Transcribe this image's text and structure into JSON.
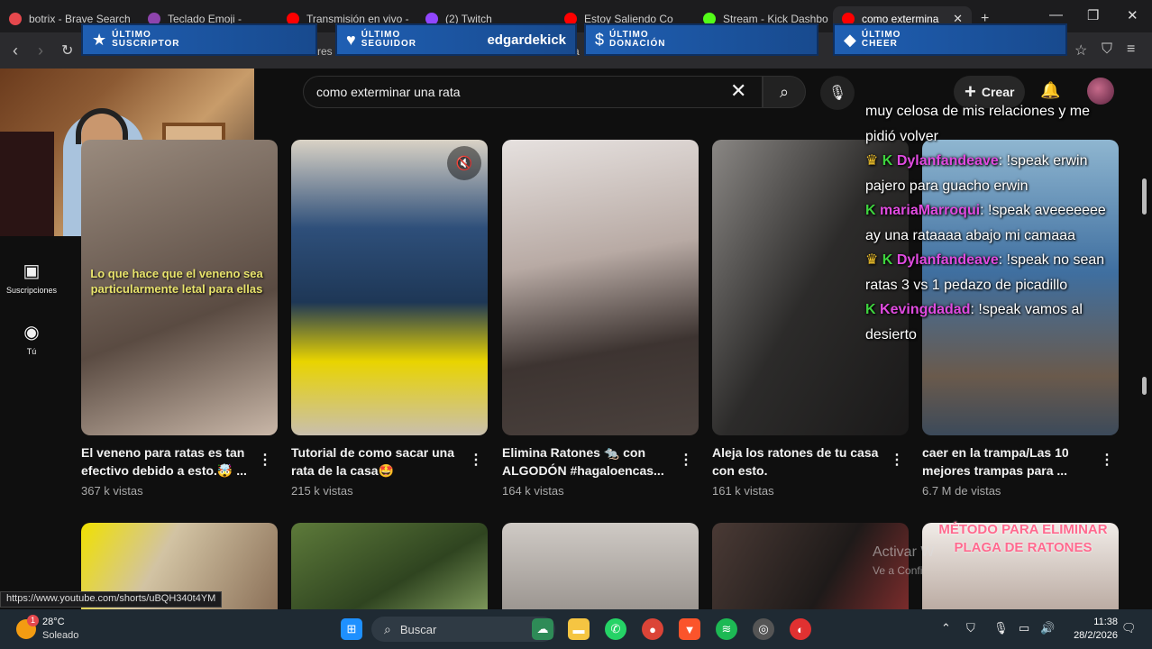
{
  "tabs": [
    {
      "title": "botrix - Brave Search",
      "color": "#e5484d"
    },
    {
      "title": "Teclado Emoji -",
      "color": "#8e44ad"
    },
    {
      "title": "Transmisión en vivo -",
      "color": "#ff0000"
    },
    {
      "title": "(2) Twitch",
      "color": "#9146ff"
    },
    {
      "title": "Estoy Saliendo Co",
      "color": "#ff0000"
    },
    {
      "title": "Stream - Kick Dashbo",
      "color": "#53fc18"
    },
    {
      "title": "como extermina",
      "color": "#ff0000",
      "active": true
    }
  ],
  "address": {
    "url_fragment_1": "res",
    "url_fragment_2": "uta"
  },
  "overlays": {
    "subscriber": {
      "label_1": "ÚLTIMO",
      "label_2": "SUSCRIPTOR",
      "value": ""
    },
    "follower": {
      "label_1": "ÚLTIMO",
      "label_2": "SEGUIDOR",
      "value": "edgardekick"
    },
    "donation": {
      "label_1": "ÚLTIMO",
      "label_2": "DONACIÓN",
      "value": ""
    },
    "cheer": {
      "label_1": "ÚLTIMO",
      "label_2": "CHEER",
      "value": ""
    }
  },
  "youtube": {
    "search_value": "como exterminar una rata",
    "create_label": "Crear",
    "sidebar": [
      {
        "label": "Suscripciones",
        "icon": "subscriptions-icon"
      },
      {
        "label": "Tú",
        "icon": "you-icon"
      }
    ]
  },
  "shorts": [
    {
      "title_1": "El veneno para ratas es tan",
      "title_2": "efectivo debido a esto.🤯 ...",
      "views": "367 k vistas",
      "thumb_text": "Lo que hace que el veneno sea particularmente letal para ellas"
    },
    {
      "title_1": "Tutorial de como sacar una",
      "title_2": "rata de la casa🤩",
      "views": "215 k vistas"
    },
    {
      "title_1": "Elimina Ratones 🐀 con",
      "title_2": "ALGODÓN #hagaloencas...",
      "views": "164 k vistas"
    },
    {
      "title_1": "Aleja los ratones de tu casa",
      "title_2": "con esto.",
      "views": "161 k vistas"
    },
    {
      "title_1": "caer en la trampa/Las 10",
      "title_2": "mejores trampas para ...",
      "views": "6.7 M de vistas"
    }
  ],
  "row2": {
    "method_text": "MÉTODO PARA ELIMINAR PLAGA DE RATONES"
  },
  "chat": [
    {
      "user": "",
      "text": "muy celosa de mis relaciones y me pidió volver",
      "crown": false,
      "k": false
    },
    {
      "user": "Dylanfandeave",
      "text": "!speak erwin pajero para guacho erwin",
      "crown": true,
      "k": true,
      "user_color": "#e04be0"
    },
    {
      "user": "mariaMarroqui",
      "text": "!speak aveeeeeee ay una rataaaa abajo mi camaaa",
      "crown": false,
      "k": true,
      "user_color": "#e04be0"
    },
    {
      "user": "Dylanfandeave",
      "text": "!speak no sean ratas 3 vs 1 pedazo de picadillo",
      "crown": true,
      "k": true,
      "user_color": "#e04be0"
    },
    {
      "user": "Kevingdadad",
      "text": "!speak vamos al desierto",
      "crown": false,
      "k": true,
      "user_color": "#e04be0"
    }
  ],
  "watermark": {
    "line_1": "Activar W",
    "line_2": "Ve a Confi"
  },
  "status_url": "https://www.youtube.com/shorts/uBQH340t4YM",
  "taskbar": {
    "temp": "28°C",
    "weather": "Soleado",
    "badge": "1",
    "search_label": "Buscar",
    "time": "11:38",
    "date": "28/2/2026"
  }
}
